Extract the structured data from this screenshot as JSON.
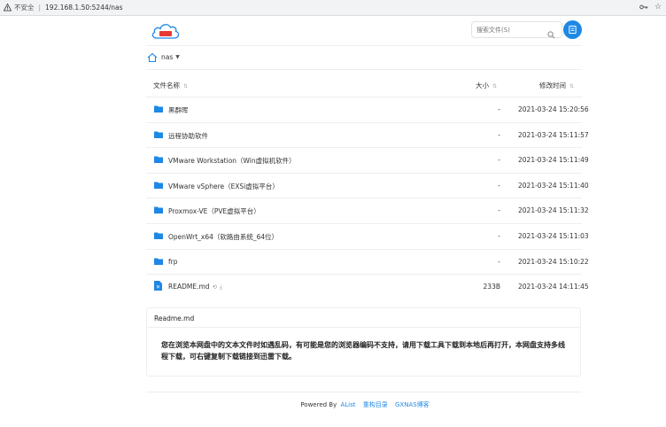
{
  "browser": {
    "insecure_label": "不安全",
    "url": "192.168.1.50:5244/nas"
  },
  "header": {
    "logo_text": "网盘",
    "logo_subtext": "GXNAS",
    "search_placeholder": "搜索文件(S)",
    "avatar_icon": "user-icon"
  },
  "breadcrumb": {
    "label": "nas"
  },
  "table": {
    "col_name": "文件名称",
    "col_size": "大小",
    "col_date": "修改时间",
    "rows": [
      {
        "name": "黑群晖",
        "size": "-",
        "date": "2021-03-24 15:20:56",
        "type": "folder"
      },
      {
        "name": "远程协助软件",
        "size": "-",
        "date": "2021-03-24 15:11:57",
        "type": "folder"
      },
      {
        "name": "VMware Workstation（Win虚拟机软件）",
        "size": "-",
        "date": "2021-03-24 15:11:49",
        "type": "folder"
      },
      {
        "name": "VMware vSphere（EXSi虚拟平台）",
        "size": "-",
        "date": "2021-03-24 15:11:40",
        "type": "folder"
      },
      {
        "name": "Proxmox-VE（PVE虚拟平台）",
        "size": "-",
        "date": "2021-03-24 15:11:32",
        "type": "folder"
      },
      {
        "name": "OpenWrt_x64（软路由系统_64位）",
        "size": "-",
        "date": "2021-03-24 15:11:03",
        "type": "folder"
      },
      {
        "name": "frp",
        "size": "-",
        "date": "2021-03-24 15:10:22",
        "type": "folder"
      },
      {
        "name": "README.md",
        "size": "233B",
        "date": "2021-03-24 14:11:45",
        "type": "file"
      }
    ]
  },
  "readme": {
    "title": "Readme.md",
    "body": "您在浏览本网盘中的文本文件时如遇乱码，有可能是您的浏览器编码不支持，请用下载工具下载到本地后再打开，本网盘支持多线程下载，可右键复制下载链接到迅雷下载。"
  },
  "footer": {
    "powered_by": "Powered By",
    "alist": "AList",
    "link1": "重构目录",
    "link2": "GXNAS博客"
  },
  "colors": {
    "accent": "#1e88e5"
  }
}
